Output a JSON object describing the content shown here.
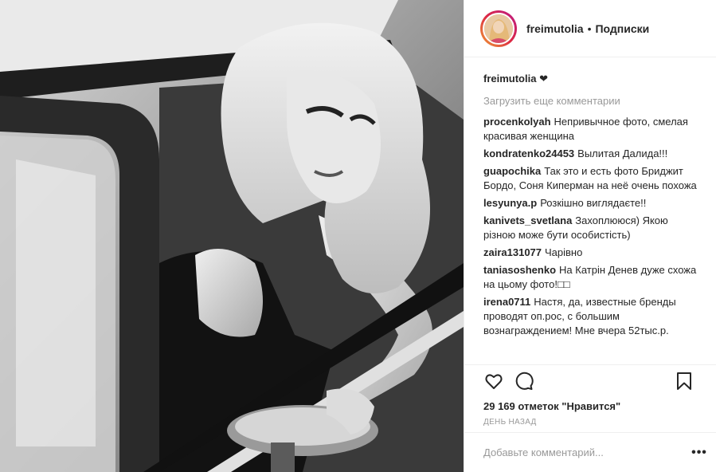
{
  "header": {
    "username": "freimutolia",
    "separator": "•",
    "follow_label": "Подписки"
  },
  "caption": {
    "username": "freimutolia",
    "text": "❤"
  },
  "load_more": "Загрузить еще комментарии",
  "comments": [
    {
      "user": "procenkolyah",
      "text": "Непривычное фото, смелая красивая женщина"
    },
    {
      "user": "kondratenko24453",
      "text": "Вылитая Далида!!!"
    },
    {
      "user": "guapochika",
      "text": "Так это и есть фото Бриджит Бордо, Соня Киперман на неё очень похожа"
    },
    {
      "user": "lesyunya.p",
      "text": "Розкішно виглядаєте!!"
    },
    {
      "user": "kanivets_svetlana",
      "text": "Захоплююся) Якою різною може бути особистість)"
    },
    {
      "user": "zaira131077",
      "text": "Чарівно"
    },
    {
      "user": "taniasoshenko",
      "text": "На Катрін Денев дуже схожа на цьому фото!□□"
    },
    {
      "user": "irena0711",
      "text": "Настя, да, известные бренды проводят оп.рос, с большим вознаграждением! Мне вчера 52тыс.р."
    }
  ],
  "icons": {
    "like": "heart-icon",
    "comment": "comment-bubble-icon",
    "save": "bookmark-icon",
    "more": "more-options-icon"
  },
  "likes_text": "29 169 отметок \"Нравится\"",
  "time_text": "день назад",
  "add_comment": {
    "placeholder": "Добавьте комментарий...",
    "more_label": "•••"
  }
}
